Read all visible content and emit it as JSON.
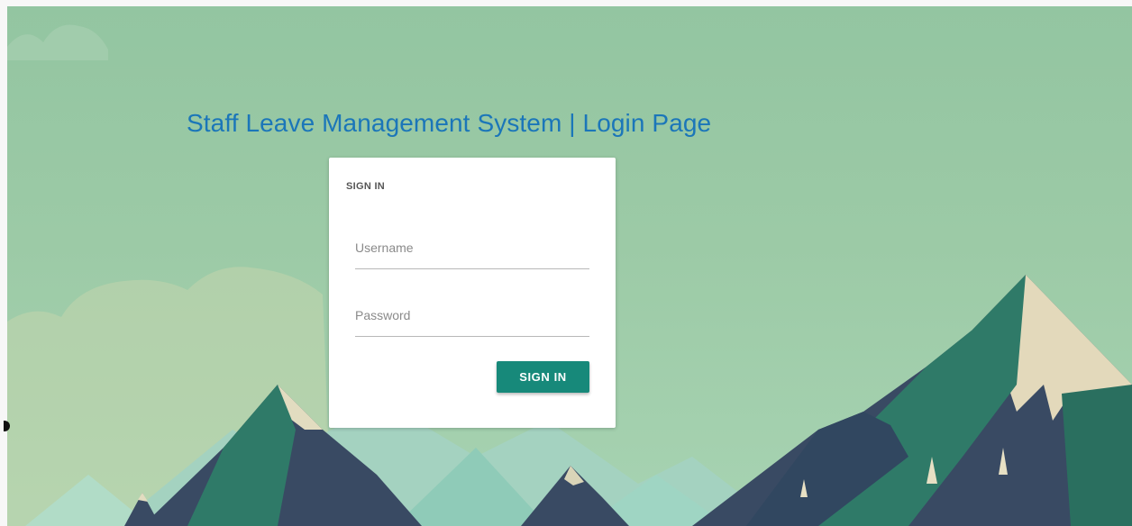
{
  "page": {
    "title": "Staff Leave Management System | Login Page"
  },
  "login_form": {
    "heading": "SIGN IN",
    "username_placeholder": "Username",
    "password_placeholder": "Password",
    "submit_label": "SIGN IN"
  },
  "colors": {
    "title": "#1b76b9",
    "button": "#17897a",
    "sky": "#93c5a1"
  },
  "icons": [
    "mountain-landscape-background"
  ]
}
